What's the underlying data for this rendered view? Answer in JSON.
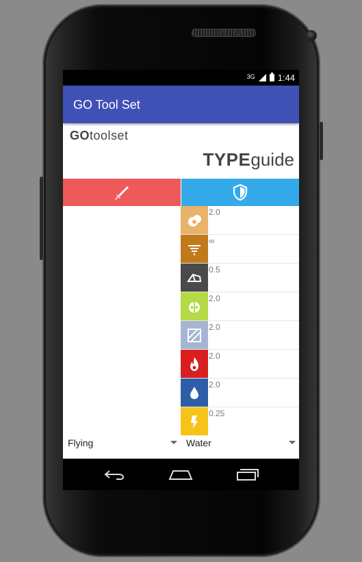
{
  "status_bar": {
    "network": "3G",
    "time": "1:44"
  },
  "app_bar": {
    "title": "GO Tool Set"
  },
  "brand": {
    "go_bold": "GO",
    "go_rest": "toolset",
    "type_bold": "TYPE",
    "type_rest": "guide"
  },
  "tabs": [
    {
      "name": "attack",
      "icon": "sword-icon",
      "color": "#EE5A5A"
    },
    {
      "name": "defense",
      "icon": "shield-icon",
      "color": "#34AAEA"
    }
  ],
  "effectiveness": [
    {
      "type_icon": "ground-type-icon",
      "color": "#E8B46A",
      "value": "2.0"
    },
    {
      "type_icon": "flying-type-icon",
      "color": "#C2791B",
      "value": "∞"
    },
    {
      "type_icon": "rock-type-icon",
      "color": "#4A4A4A",
      "value": "0.5"
    },
    {
      "type_icon": "bug-type-icon",
      "color": "#B5DA45",
      "value": "2.0"
    },
    {
      "type_icon": "ice-type-icon",
      "color": "#A5B6D2",
      "value": "2.0"
    },
    {
      "type_icon": "fire-type-icon",
      "color": "#D81E1E",
      "value": "2.0"
    },
    {
      "type_icon": "water-type-icon",
      "color": "#2E5EA8",
      "value": "2.0"
    },
    {
      "type_icon": "electric-type-icon",
      "color": "#F6C31A",
      "value": "0.25"
    }
  ],
  "spinners": {
    "attack_type": "Flying",
    "defense_type": "Water"
  }
}
